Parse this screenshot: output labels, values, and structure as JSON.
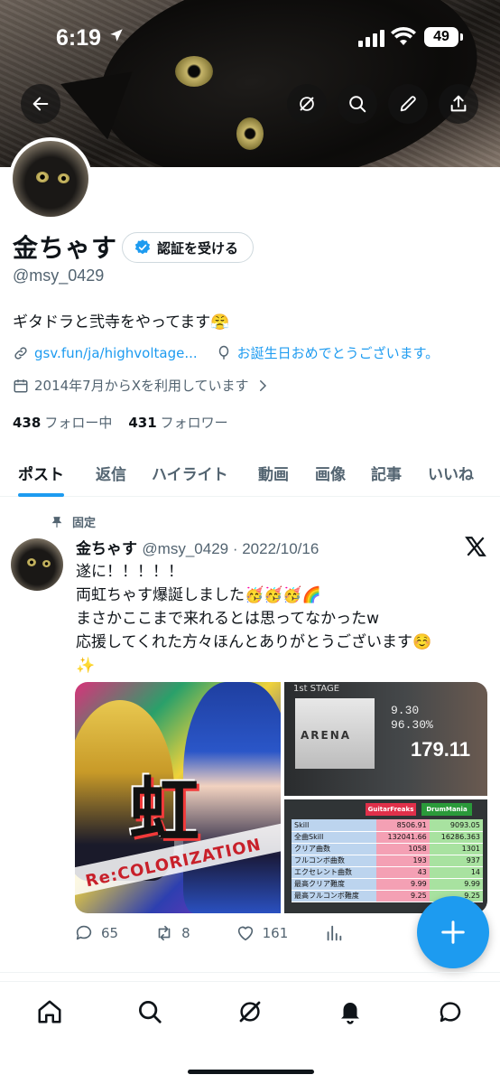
{
  "status_bar": {
    "time": "6:19",
    "battery": "49"
  },
  "profile": {
    "name": "金ちゃす",
    "verify_label": "認証を受ける",
    "handle": "@msy_0429",
    "bio": "ギタドラと弐寺をやってます😤",
    "link": "gsv.fun/ja/highvoltage...",
    "birthday": "お誕生日おめでとうございます。",
    "joined": "2014年7月からXを利用しています",
    "following_count": "438",
    "following_label": "フォロー中",
    "followers_count": "431",
    "followers_label": "フォロワー"
  },
  "tabs": [
    "ポスト",
    "返信",
    "ハイライト",
    "動画",
    "画像",
    "記事",
    "いいね"
  ],
  "post": {
    "pinned_label": "固定",
    "author": "金ちゃす",
    "meta": "@msy_0429 · 2022/10/16",
    "lines": [
      "遂に！！！！！",
      "両虹ちゃす爆誕しました🥳🥳🥳🌈",
      "まさかここまで来れるとは思ってなかったw",
      "応援してくれた方々ほんとありがとうございます☺️",
      "✨"
    ],
    "media": {
      "left_kanji": "虹",
      "left_caption": "Re:COLORIZATION",
      "stage": "1st STAGE",
      "jacket_text": "ARENA",
      "score_small": "9.30",
      "score_pct": "96.30%",
      "score_big": "179.11",
      "gf_label": "GuitarFreaks",
      "dm_label": "DrumMania",
      "rows": [
        {
          "label": "Skill",
          "gf": "8506.91",
          "dm": "9093.05"
        },
        {
          "label": "全曲Skill",
          "gf": "132041.66",
          "dm": "16286.363"
        },
        {
          "label": "クリア曲数",
          "gf": "1058",
          "dm": "1301"
        },
        {
          "label": "フルコンボ曲数",
          "gf": "193",
          "dm": "937"
        },
        {
          "label": "エクセレント曲数",
          "gf": "43",
          "dm": "14"
        },
        {
          "label": "最高クリア難度",
          "gf": "9.99",
          "dm": "9.99"
        },
        {
          "label": "最高フルコンボ難度",
          "gf": "9.25",
          "dm": "9.25"
        }
      ]
    },
    "replies": "65",
    "reposts": "8",
    "likes": "161"
  },
  "colors": {
    "accent": "#1d9bf0",
    "text": "#0f1419",
    "muted": "#536471"
  }
}
